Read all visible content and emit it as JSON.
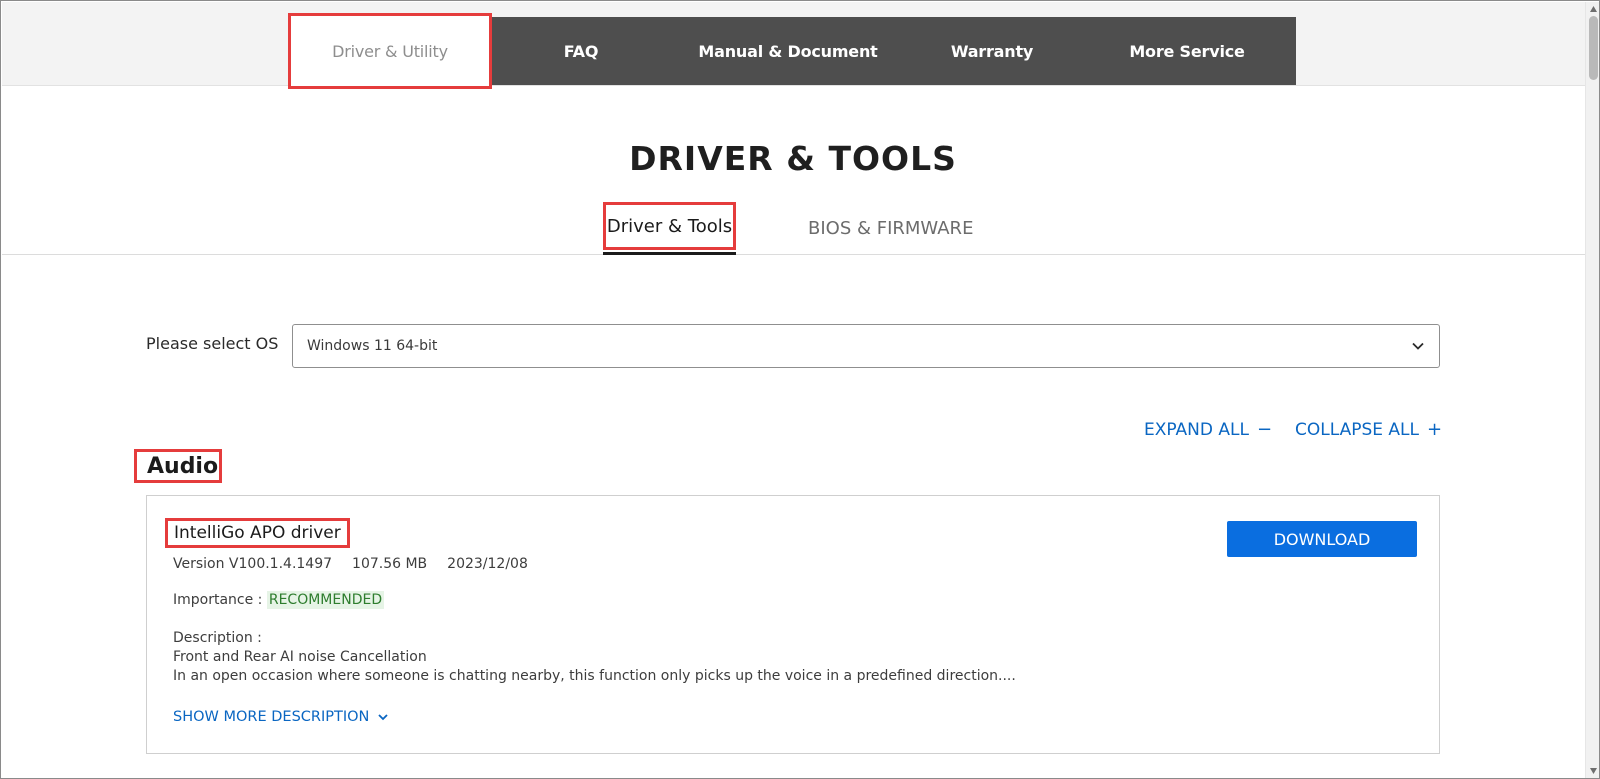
{
  "service_nav": {
    "tabs": [
      {
        "label": "Driver & Utility",
        "active": true
      },
      {
        "label": "FAQ"
      },
      {
        "label": "Manual & Document"
      },
      {
        "label": "Warranty"
      },
      {
        "label": "More Service"
      }
    ]
  },
  "page_title": "DRIVER & TOOLS",
  "sub_tabs": {
    "active": "Driver & Tools",
    "bios": "BIOS & FIRMWARE"
  },
  "os": {
    "label": "Please select OS",
    "selected": "Windows 11 64-bit"
  },
  "controls": {
    "expand_all": "EXPAND ALL",
    "collapse_all": "COLLAPSE ALL"
  },
  "section": {
    "heading": "Audio"
  },
  "driver": {
    "name": "IntelliGo APO driver",
    "version": "Version V100.1.4.1497",
    "size": "107.56 MB",
    "date": "2023/12/08",
    "importance_label": "Importance :",
    "importance_value": "RECOMMENDED",
    "description_label": "Description :",
    "description_line1": "Front and Rear AI noise Cancellation",
    "description_line2": "In an open occasion where someone is chatting nearby, this function only picks up the voice in a predefined direction....",
    "show_more": "SHOW MORE DESCRIPTION",
    "download": "DOWNLOAD"
  },
  "colors": {
    "accent_blue": "#0a6ee0",
    "highlight_red": "#e53c3c",
    "nav_bg": "#4e4e4e",
    "recommended_green": "#2e7d2e"
  }
}
